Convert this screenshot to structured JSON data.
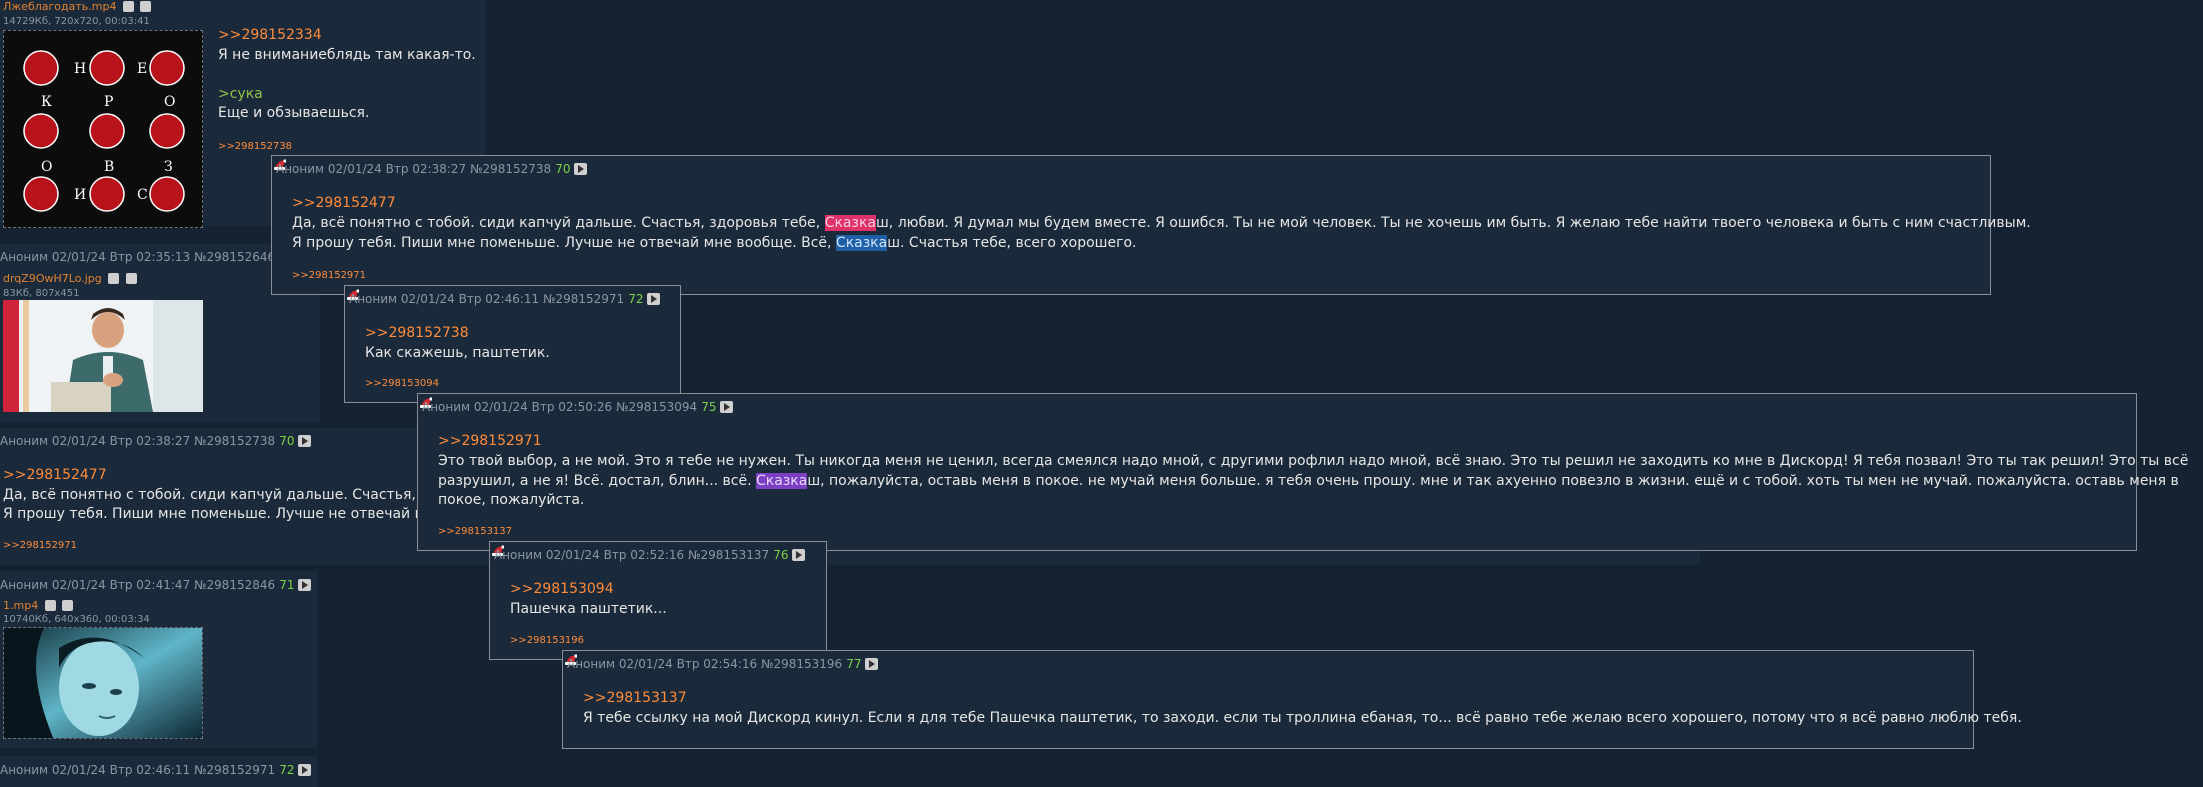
{
  "posts": {
    "p1": {
      "filename": "Лжеблагодать.mp4",
      "fileinfo": "14729Кб, 720x720, 00:03:41",
      "link": ">>298152334",
      "line1": "Я не вниманиеблядь там какая-то.",
      "greentext": ">сука",
      "line2": "Еще и обзываешься.",
      "reply": ">>298152738",
      "thumb_letters": [
        "Н",
        "Е",
        "К",
        "Р",
        "О",
        "О",
        "В",
        "З",
        "И",
        "С"
      ]
    },
    "p2": {
      "header": "Аноним  02/01/24 Втр 02:35:13 №298152646",
      "filename": "drqZ9OwH7Lo.jpg",
      "fileinfo": "83Кб, 807x451"
    },
    "p3": {
      "header": "Аноним  02/01/24 Втр 02:38:27 №298152738",
      "count": "70",
      "link": ">>298152477",
      "line1": "Да, всё понятно с тобой. сиди капчуй дальше. Счастья, зд",
      "line2": "Я прошу тебя. Пиши мне поменьше. Лучше не отвечай мне",
      "reply": ">>298152971"
    },
    "p4": {
      "header": "Аноним  02/01/24 Втр 02:41:47 №298152846",
      "count": "71",
      "filename": "1.mp4",
      "fileinfo": "10740Кб, 640x360, 00:03:34"
    },
    "p5": {
      "header": "Аноним  02/01/24 Втр 02:46:11 №298152971",
      "count": "72"
    }
  },
  "popups": {
    "c1": {
      "header": "Аноним  02/01/24 Втр 02:38:27 №298152738",
      "count": "70",
      "link": ">>298152477",
      "l1a": "Да, всё понятно с тобой. сиди капчуй дальше. Счастья, здоровья тебе, ",
      "l1hl": "Сказка",
      "l1b": "ш, любви. Я думал мы будем вместе. Я ошибся. Ты не мой человек. Ты не хочешь им быть. Я желаю тебе найти твоего человека и быть с ним счастливым.",
      "l2a": "Я прошу тебя. Пиши мне поменьше. Лучше не отвечай мне вообще. Всё, ",
      "l2hl": "Сказка",
      "l2b": "ш. Счастья тебе, всего хорошего.",
      "reply": ">>298152971"
    },
    "c2": {
      "header": "Аноним  02/01/24 Втр 02:46:11 №298152971",
      "count": "72",
      "link": ">>298152738",
      "text": "Как скажешь, паштетик.",
      "reply": ">>298153094"
    },
    "c3": {
      "header": "Аноним  02/01/24 Втр 02:50:26 №298153094",
      "count": "75",
      "link": ">>298152971",
      "l1": "Это твой выбор, а не мой. Это я тебе не нужен. Ты никогда меня не ценил, всегда смеялся надо мной, с другими рофлил надо мной, всё знаю. Это ты решил не заходить ко мне в Дискорд! Я тебя позвал! Это ты так решил! Это ты всё",
      "l2a": "разрушил, а не я! Всё. достал, блин... всё. ",
      "l2hl": "Сказка",
      "l2b": "ш, пожалуйста, оставь меня в покое. не мучай меня больше. я тебя очень прошу. мне и так ахуенно повезло в жизни. ещё и с тобой. хоть ты мен не мучай. пожалуйста. оставь меня в",
      "l3": "покое, пожалуйста.",
      "reply": ">>298153137"
    },
    "c4": {
      "header": "Аноним  02/01/24 Втр 02:52:16 №298153137",
      "count": "76",
      "link": ">>298153094",
      "text": "Пашечка паштетик...",
      "reply": ">>298153196"
    },
    "c5": {
      "header": "Аноним  02/01/24 Втр 02:54:16 №298153196",
      "count": "77",
      "link": ">>298153137",
      "text": "Я тебе ссылку на мой Дискорд кинул. Если я для тебе Пашечка паштетик, то заходи. если ты троллина ебаная, то... всё равно тебе желаю всего хорошего, потому что я всё равно люблю тебя."
    }
  },
  "colors": {
    "background": "#152231",
    "post_bg": "#1b2a3a",
    "link": "#ff8c3a",
    "count": "#7bd148",
    "greentext": "#8fc34a",
    "highlight_pink": "#e0306a",
    "highlight_blue": "#1f5fa8",
    "highlight_purple": "#7a3fc2"
  }
}
